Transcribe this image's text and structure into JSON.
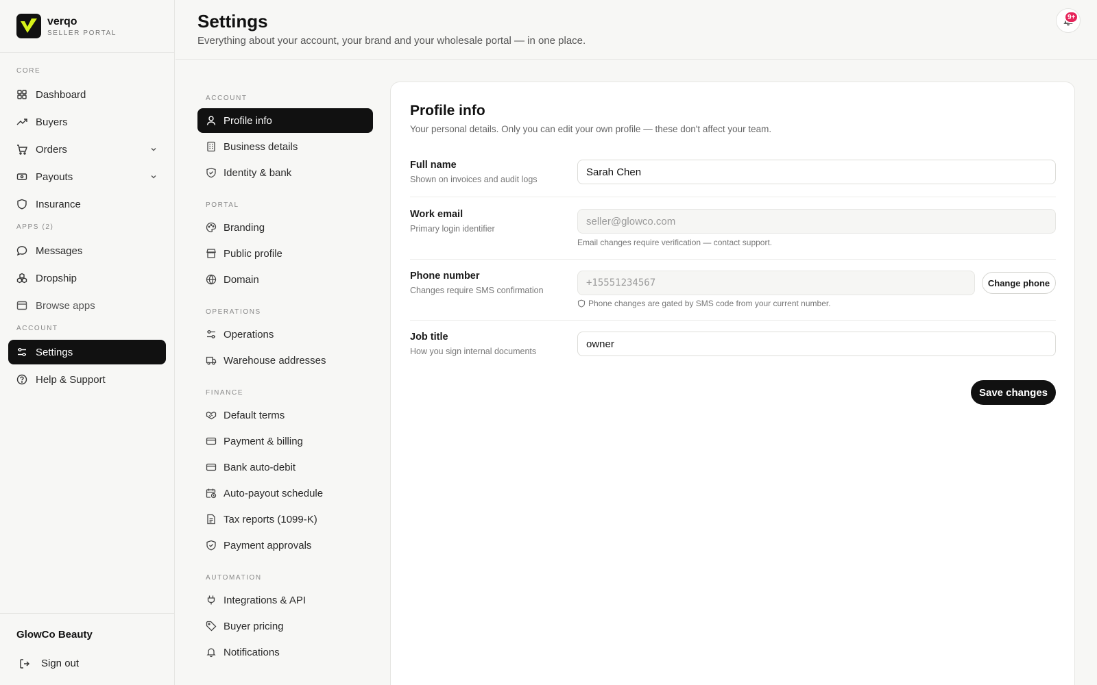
{
  "brand": {
    "name": "verqo",
    "subtitle": "SELLER PORTAL"
  },
  "sidebar": {
    "sections": [
      {
        "title": "CORE",
        "items": [
          {
            "label": "Dashboard",
            "icon": "dashboard-icon"
          },
          {
            "label": "Buyers",
            "icon": "trending-up-icon"
          },
          {
            "label": "Orders",
            "icon": "cart-icon",
            "expandable": true
          },
          {
            "label": "Payouts",
            "icon": "payout-icon",
            "expandable": true
          },
          {
            "label": "Insurance",
            "icon": "shield-icon"
          }
        ]
      },
      {
        "title": "APPS (2)",
        "items": [
          {
            "label": "Messages",
            "icon": "message-icon"
          },
          {
            "label": "Dropship",
            "icon": "boxes-icon"
          },
          {
            "label": "Browse apps",
            "icon": "browser-icon"
          }
        ]
      },
      {
        "title": "ACCOUNT",
        "items": [
          {
            "label": "Settings",
            "icon": "sliders-icon",
            "active": true
          },
          {
            "label": "Help & Support",
            "icon": "help-icon"
          }
        ]
      }
    ],
    "company": "GlowCo Beauty",
    "signout": "Sign out"
  },
  "header": {
    "title": "Settings",
    "subtitle": "Everything about your account, your brand and your wholesale portal — in one place.",
    "notification_count": "9+"
  },
  "settings_nav": [
    {
      "title": "ACCOUNT",
      "items": [
        {
          "label": "Profile info",
          "active": true
        },
        {
          "label": "Business details"
        },
        {
          "label": "Identity & bank"
        }
      ]
    },
    {
      "title": "PORTAL",
      "items": [
        {
          "label": "Branding"
        },
        {
          "label": "Public profile"
        },
        {
          "label": "Domain"
        }
      ]
    },
    {
      "title": "OPERATIONS",
      "items": [
        {
          "label": "Operations"
        },
        {
          "label": "Warehouse addresses"
        }
      ]
    },
    {
      "title": "FINANCE",
      "items": [
        {
          "label": "Default terms"
        },
        {
          "label": "Payment & billing"
        },
        {
          "label": "Bank auto-debit"
        },
        {
          "label": "Auto-payout schedule"
        },
        {
          "label": "Tax reports (1099-K)"
        },
        {
          "label": "Payment approvals"
        }
      ]
    },
    {
      "title": "AUTOMATION",
      "items": [
        {
          "label": "Integrations & API"
        },
        {
          "label": "Buyer pricing"
        },
        {
          "label": "Notifications"
        }
      ]
    }
  ],
  "profile": {
    "title": "Profile info",
    "subtitle": "Your personal details. Only you can edit your own profile — these don't affect your team.",
    "full_name": {
      "label": "Full name",
      "help": "Shown on invoices and audit logs",
      "value": "Sarah Chen"
    },
    "work_email": {
      "label": "Work email",
      "help": "Primary login identifier",
      "value": "seller@glowco.com",
      "note": "Email changes require verification — contact support."
    },
    "phone": {
      "label": "Phone number",
      "help": "Changes require SMS confirmation",
      "value": "+15551234567",
      "button": "Change phone",
      "note": "Phone changes are gated by SMS code from your current number."
    },
    "job_title": {
      "label": "Job title",
      "help": "How you sign internal documents",
      "value": "owner"
    },
    "save": "Save changes"
  }
}
